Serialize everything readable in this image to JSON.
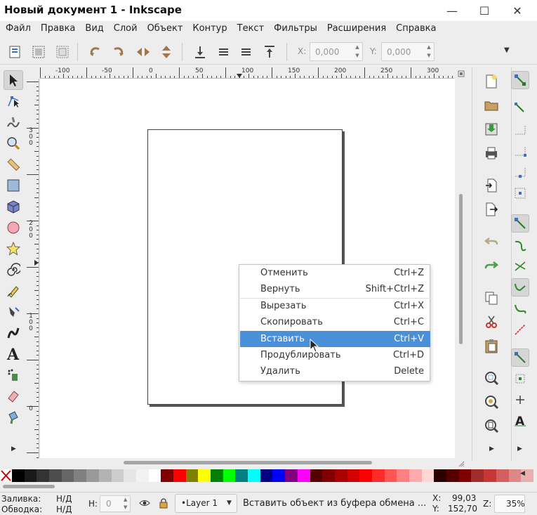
{
  "window": {
    "title": "Новый документ 1 - Inkscape",
    "controls": {
      "minimize": "—",
      "maximize": "☐",
      "close": "✕"
    }
  },
  "menubar": [
    "Файл",
    "Правка",
    "Вид",
    "Слой",
    "Объект",
    "Контур",
    "Текст",
    "Фильтры",
    "Расширения",
    "Справка"
  ],
  "toolbar": {
    "x_label": "X:",
    "x_value": "0,000",
    "y_label": "Y:",
    "y_value": "0,000",
    "overflow": "▼"
  },
  "ruler": {
    "h_labels": [
      "-100",
      "-50",
      "0",
      "50",
      "100",
      "150",
      "200",
      "250",
      "300"
    ],
    "v_labels": [
      "300",
      "200",
      "100",
      "0"
    ]
  },
  "context_menu": [
    {
      "label": "Отменить",
      "shortcut": "Ctrl+Z",
      "highlighted": false
    },
    {
      "label": "Вернуть",
      "shortcut": "Shift+Ctrl+Z",
      "highlighted": false
    },
    {
      "label": "Вырезать",
      "shortcut": "Ctrl+X",
      "highlighted": false
    },
    {
      "label": "Скопировать",
      "shortcut": "Ctrl+C",
      "highlighted": false
    },
    {
      "label": "Вставить",
      "shortcut": "Ctrl+V",
      "highlighted": true
    },
    {
      "label": "Продублировать",
      "shortcut": "Ctrl+D",
      "highlighted": false
    },
    {
      "label": "Удалить",
      "shortcut": "Delete",
      "highlighted": false
    }
  ],
  "palette": [
    "#000000",
    "#1a1a1a",
    "#333333",
    "#4d4d4d",
    "#666666",
    "#808080",
    "#999999",
    "#b3b3b3",
    "#cccccc",
    "#e6e6e6",
    "#f2f2f2",
    "#ffffff",
    "#800000",
    "#ff0000",
    "#808000",
    "#ffff00",
    "#008000",
    "#00ff00",
    "#008080",
    "#00ffff",
    "#000080",
    "#0000ff",
    "#800080",
    "#ff00ff",
    "#550000",
    "#800000",
    "#aa0000",
    "#d40000",
    "#ff0000",
    "#ff2a2a",
    "#ff5555",
    "#ff8080",
    "#ffaaaa",
    "#ffd5d5",
    "#2b0000",
    "#550000",
    "#800000",
    "#a02c2c",
    "#c83737",
    "#d35f5f",
    "#de8787",
    "#e9afaf"
  ],
  "status": {
    "fill_label": "Заливка:",
    "fill_value": "Н/Д",
    "stroke_label": "Обводка:",
    "stroke_value": "Н/Д",
    "h_label": "H:",
    "h_value": "0",
    "layer": "•Layer 1",
    "message": "Вставить объект из буфера обмена ...",
    "x_label": "X:",
    "x_value": "99,03",
    "y_label": "Y:",
    "y_value": "152,70",
    "z_label": "Z:",
    "zoom": "35%"
  }
}
